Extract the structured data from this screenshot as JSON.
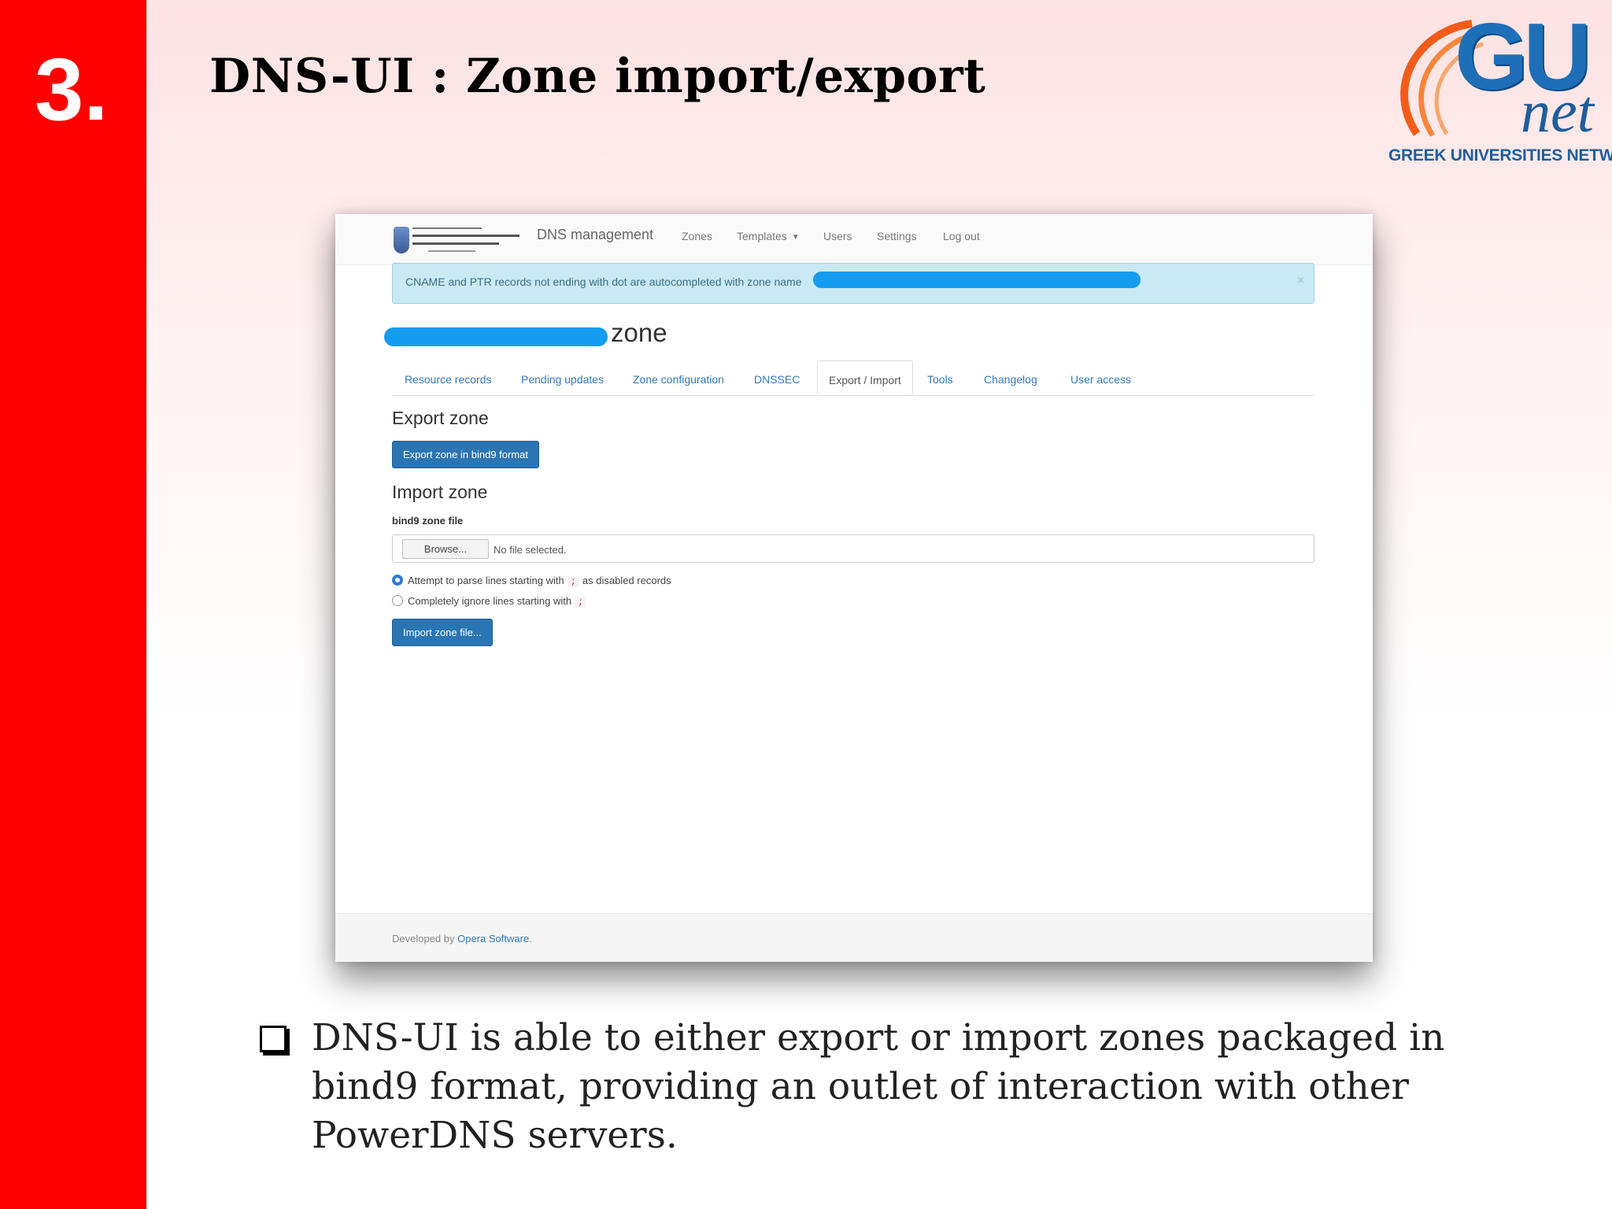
{
  "slide": {
    "number": "3.",
    "title": "DNS-UI : Zone import/export",
    "logo": {
      "mark": "GU",
      "word": "net",
      "subtitle": "GREEK UNIVERSITIES NETWORK"
    },
    "bullet_text": "DNS-UI is able to either export or import zones packaged in bind9 format, providing an outlet of interaction with other PowerDNS servers."
  },
  "app": {
    "brand": "DNS management",
    "nav": [
      "Zones",
      "Templates",
      "Users",
      "Settings",
      "Log out"
    ],
    "alert": {
      "text": "CNAME and PTR records not ending with dot are autocompleted with zone name",
      "close": "×"
    },
    "zone_word": "zone",
    "tabs": [
      "Resource records",
      "Pending updates",
      "Zone configuration",
      "DNSSEC",
      "Export / Import",
      "Tools",
      "Changelog",
      "User access"
    ],
    "active_tab": "Export / Import",
    "export": {
      "heading": "Export zone",
      "button": "Export zone in bind9 format"
    },
    "import": {
      "heading": "Import zone",
      "file_label": "bind9 zone file",
      "browse_label": "Browse...",
      "file_status": "No file selected.",
      "option1_before": "Attempt to parse lines starting with",
      "option1_after": "as disabled records",
      "option2": "Completely ignore lines starting with",
      "comment_char": ";",
      "button": "Import zone file..."
    },
    "footer": {
      "prefix": "Developed by",
      "link": "Opera Software",
      "suffix": "."
    }
  },
  "colors": {
    "red_bar": "#ff0000",
    "primary_button": "#2a75b3",
    "link": "#337ab7",
    "alert_bg": "#c9e9f5",
    "redaction": "#149cf0"
  }
}
